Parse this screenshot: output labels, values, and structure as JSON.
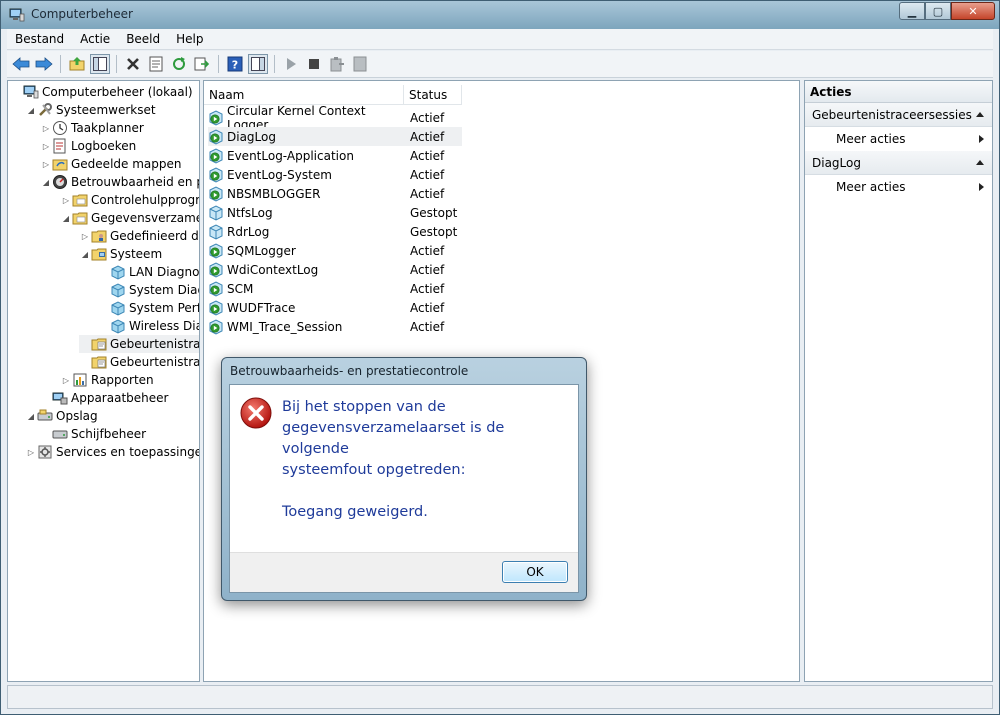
{
  "window": {
    "title": "Computerbeheer"
  },
  "menu": [
    "Bestand",
    "Actie",
    "Beeld",
    "Help"
  ],
  "tree": [
    {
      "label": "Computerbeheer (lokaal)",
      "level": 0,
      "expander": "",
      "icon": "computer-icon"
    },
    {
      "label": "Systeemwerkset",
      "level": 1,
      "expander": "expanded",
      "icon": "tools-icon"
    },
    {
      "label": "Taakplanner",
      "level": 2,
      "expander": "collapsed",
      "icon": "clock-icon"
    },
    {
      "label": "Logboeken",
      "level": 2,
      "expander": "collapsed",
      "icon": "log-icon"
    },
    {
      "label": "Gedeelde mappen",
      "level": 2,
      "expander": "collapsed",
      "icon": "shared-folder-icon"
    },
    {
      "label": "Betrouwbaarheid en pre",
      "level": 2,
      "expander": "expanded",
      "icon": "gauge-icon"
    },
    {
      "label": "Controlehulpprogra",
      "level": 3,
      "expander": "collapsed",
      "icon": "folder-icon"
    },
    {
      "label": "Gegevensverzamela",
      "level": 3,
      "expander": "expanded",
      "icon": "folder-icon"
    },
    {
      "label": "Gedefinieerd doo",
      "level": 4,
      "expander": "collapsed",
      "icon": "user-folder-icon"
    },
    {
      "label": "Systeem",
      "level": 4,
      "expander": "expanded",
      "icon": "system-folder-icon"
    },
    {
      "label": "LAN Diagnos",
      "level": 5,
      "expander": "",
      "icon": "datacollector-icon"
    },
    {
      "label": "System Diagr",
      "level": 5,
      "expander": "",
      "icon": "datacollector-icon"
    },
    {
      "label": "System Perfo",
      "level": 5,
      "expander": "",
      "icon": "datacollector-icon"
    },
    {
      "label": "Wireless Diag",
      "level": 5,
      "expander": "",
      "icon": "datacollector-icon"
    },
    {
      "label": "Gebeurtenistrace",
      "level": 4,
      "expander": "",
      "icon": "trace-folder-icon",
      "selected": true
    },
    {
      "label": "Gebeurtenistrace",
      "level": 4,
      "expander": "",
      "icon": "trace-folder-icon"
    },
    {
      "label": "Rapporten",
      "level": 3,
      "expander": "collapsed",
      "icon": "report-icon"
    },
    {
      "label": "Apparaatbeheer",
      "level": 2,
      "expander": "",
      "icon": "device-icon"
    },
    {
      "label": "Opslag",
      "level": 1,
      "expander": "expanded",
      "icon": "storage-icon"
    },
    {
      "label": "Schijfbeheer",
      "level": 2,
      "expander": "",
      "icon": "disk-icon"
    },
    {
      "label": "Services en toepassingen",
      "level": 1,
      "expander": "collapsed",
      "icon": "services-icon"
    }
  ],
  "list": {
    "columns": [
      "Naam",
      "Status"
    ],
    "rows": [
      {
        "name": "Circular Kernel Context Logger",
        "status": "Actief"
      },
      {
        "name": "DiagLog",
        "status": "Actief",
        "selected": true
      },
      {
        "name": "EventLog-Application",
        "status": "Actief"
      },
      {
        "name": "EventLog-System",
        "status": "Actief"
      },
      {
        "name": "NBSMBLOGGER",
        "status": "Actief"
      },
      {
        "name": "NtfsLog",
        "status": "Gestopt"
      },
      {
        "name": "RdrLog",
        "status": "Gestopt"
      },
      {
        "name": "SQMLogger",
        "status": "Actief"
      },
      {
        "name": "WdiContextLog",
        "status": "Actief"
      },
      {
        "name": "SCM",
        "status": "Actief"
      },
      {
        "name": "WUDFTrace",
        "status": "Actief"
      },
      {
        "name": "WMI_Trace_Session",
        "status": "Actief"
      }
    ]
  },
  "actions": {
    "header": "Acties",
    "sections": [
      {
        "title": "Gebeurtenistraceersessies",
        "item": "Meer acties"
      },
      {
        "title": "DiagLog",
        "item": "Meer acties"
      }
    ]
  },
  "dialog": {
    "title": "Betrouwbaarheids- en prestatiecontrole",
    "lines": [
      "Bij het stoppen van de",
      "gegevensverzamelaarset is de volgende",
      "systeemfout opgetreden:"
    ],
    "detail": "Toegang geweigerd.",
    "ok_label": "OK"
  },
  "colors": {
    "message_text": "#1f3b9a",
    "error_red": "#c8201c",
    "status_running": "#2f9a2f"
  }
}
